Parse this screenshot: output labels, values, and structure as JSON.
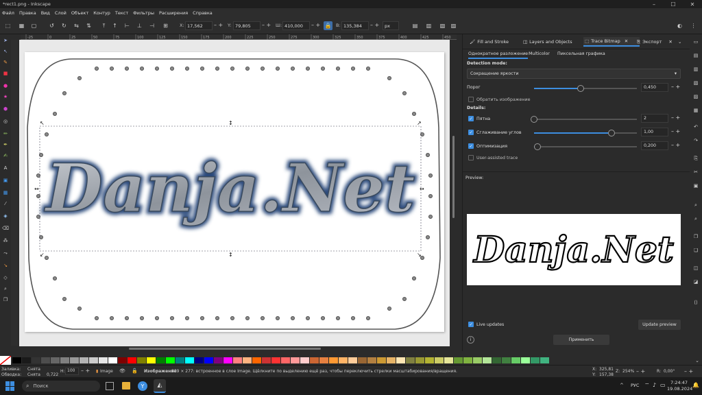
{
  "window": {
    "title": "*rect1.png - Inkscape"
  },
  "menu": [
    "Файл",
    "Правка",
    "Вид",
    "Слой",
    "Объект",
    "Контур",
    "Текст",
    "Фильтры",
    "Расширения",
    "Справка"
  ],
  "toolbar": {
    "x_label": "X:",
    "x": "17,562",
    "y_label": "Y:",
    "y": "79,805",
    "w_label": "Ш:",
    "w": "410,000",
    "h_label": "В:",
    "h": "135,384",
    "unit": "px"
  },
  "ruler": [
    "-25",
    "0",
    "25",
    "50",
    "75",
    "100",
    "125",
    "150",
    "175",
    "200",
    "225",
    "250",
    "275",
    "300",
    "325",
    "350",
    "375",
    "400",
    "425",
    "450"
  ],
  "dock": {
    "tabs": [
      "Fill and Stroke",
      "Layers and Objects",
      "Trace Bitmap",
      "Экспорт"
    ],
    "subtabs": [
      "Однократное разложение",
      "Multicolor",
      "Пиксельная графика"
    ],
    "detection_label": "Detection mode:",
    "detection_value": "Сокращение яркости",
    "threshold_label": "Порог",
    "threshold_value": "0,450",
    "threshold_fraction": 0.45,
    "invert_label": "Обратить изображение",
    "details_label": "Details:",
    "speckles_label": "Пятна",
    "speckles_value": "2",
    "speckles_fraction": 0.0,
    "smooth_label": "Сглаживание углов",
    "smooth_value": "1,00",
    "smooth_fraction": 0.75,
    "optimize_label": "Оптимизация",
    "optimize_value": "0,200",
    "optimize_fraction": 0.03,
    "user_assisted_label": "User-assisted trace",
    "preview_label": "Preview:",
    "live_updates_label": "Live updates",
    "update_preview_label": "Update preview",
    "apply_label": "Применить"
  },
  "canvas": {
    "logo_text": "Danja.Net"
  },
  "colors": {
    "accent": "#3d8ee0",
    "logo_fill": "#9ea3ab",
    "logo_glow": "#2a4a7a"
  },
  "palette": [
    "#000000",
    "#1a1a1a",
    "#333333",
    "#4d4d4d",
    "#666666",
    "#808080",
    "#999999",
    "#b3b3b3",
    "#cccccc",
    "#e6e6e6",
    "#ffffff",
    "#800000",
    "#ff0000",
    "#808000",
    "#ffff00",
    "#008000",
    "#00ff00",
    "#008080",
    "#00ffff",
    "#000080",
    "#0000ff",
    "#800080",
    "#ff00ff",
    "#ff8080",
    "#ffb380",
    "#ff6600",
    "#cc3333",
    "#ff3333",
    "#ff6666",
    "#ff9999",
    "#ffcccc",
    "#cc6633",
    "#e68040",
    "#ff9933",
    "#ffb366",
    "#ffcc99",
    "#996633",
    "#b38040",
    "#cc9933",
    "#e6b366",
    "#ffe6b3",
    "#808040",
    "#999933",
    "#b3b333",
    "#cccc66",
    "#e6e699",
    "#669933",
    "#80b340",
    "#99cc66",
    "#b3e699",
    "#336633",
    "#408040",
    "#66cc66",
    "#99ff99",
    "#339966",
    "#40b380"
  ],
  "status": {
    "fill_label": "Заливка:",
    "fill_value": "Снята",
    "stroke_label": "Обводка:",
    "stroke_value": "Снята",
    "stroke_width": "0,722",
    "opacity_label": "Н:",
    "opacity": "100",
    "layer": "Image",
    "message_bold": "Изображение",
    "message": " 839 × 277: встроенное в слое Image. Щёлкните по выделению ещё раз, чтобы переключить стрелки масштабирования/вращения.",
    "x_label": "X:",
    "x": "325,81",
    "y_label": "Y:",
    "y": "157,38",
    "zoom_label": "Z:",
    "zoom": "254%",
    "rot_label": "R:",
    "rot": "0,00°"
  },
  "taskbar": {
    "search_placeholder": "Поиск",
    "lang": "РУС",
    "time": "7:24:47",
    "date": "19.08.2024"
  }
}
